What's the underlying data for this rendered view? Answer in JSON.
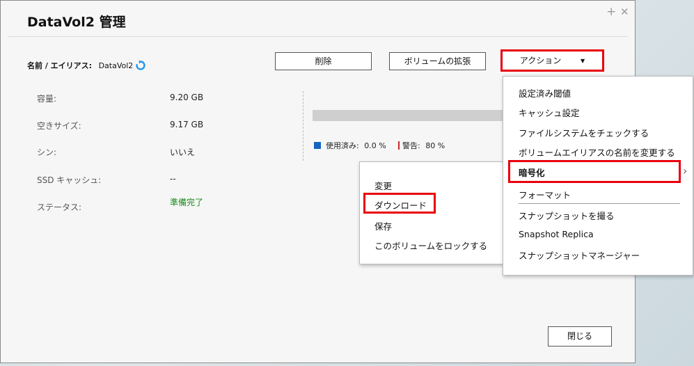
{
  "window": {
    "title": "DataVol2 管理",
    "plus_glyph": "+",
    "close_glyph": "✕"
  },
  "name_row": {
    "label": "名前 / エイリアス:",
    "value": "DataVol2"
  },
  "buttons": {
    "delete": "削除",
    "extend": "ボリュームの拡張",
    "action": "アクション",
    "close": "閉じる"
  },
  "info": [
    {
      "label": "容量:",
      "value": "9.20 GB"
    },
    {
      "label": "空きサイズ:",
      "value": "9.17 GB"
    },
    {
      "label": "シン:",
      "value": "いいえ"
    },
    {
      "label": "SSD キャッシュ:",
      "value": "--"
    },
    {
      "label": "ステータス:",
      "value": "準備完了"
    }
  ],
  "usage": {
    "used_label": "使用済み:",
    "used_value": "0.0 %",
    "warn_label": "警告:",
    "warn_value": "80 %",
    "used_fraction": 0.0
  },
  "colors": {
    "status_ready": "#1a8a1a",
    "used_swatch": "#1565c0",
    "warn_swatch": "#c62828",
    "highlight": "#e8000b"
  },
  "sub_menu": {
    "items": [
      "変更",
      "ダウンロード",
      "保存",
      "このボリュームをロックする"
    ]
  },
  "action_menu": {
    "items": [
      "設定済み閾値",
      "キャッシュ設定",
      "ファイルシステムをチェックする",
      "ボリュームエイリアスの名前を変更する",
      "暗号化",
      "フォーマット",
      "スナップショットを撮る",
      "Snapshot Replica",
      "スナップショットマネージャー"
    ],
    "submenu_glyph": "›"
  }
}
